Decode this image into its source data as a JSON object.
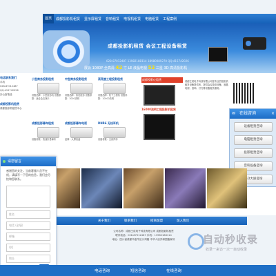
{
  "nav": {
    "items": [
      "首页",
      "成都投影机租赁",
      "显示屏租赁",
      "音响租赁",
      "电视机租赁",
      "电脑租赁",
      "工程案例"
    ]
  },
  "banner": {
    "headline": "成都投影机租赁 会议工程设备租赁",
    "contact": "028-87012487 13982188114 18980089270 QQ:415742026",
    "strip_pre": "展会 1080P 全高清",
    "strip_num1": "42",
    "strip_mid": "寸 LE 液晶电视",
    "strip_num2": "52",
    "strip_end": "三星 3D 高清投影机"
  },
  "sidebar": {
    "title": "电话联系我们",
    "lines": [
      "手机",
      "028-87012487",
      "QQ:415742026",
      "办公室电话"
    ],
    "title2": "成都投影机租赁",
    "lines2": [
      "成都投影机租赁中心"
    ]
  },
  "products": [
    {
      "title": "小型商务投影租赁",
      "desc": "设备品牌：小型投影机 设备参数：适合会议演示"
    },
    {
      "title": "中型商务投影租赁",
      "desc": "设备品牌：索尼投影 设备参数：3000流明"
    },
    {
      "title": "高亮度工程投影租赁",
      "desc": "设备品牌：松下工程机 设备参数：10000流明"
    },
    {
      "title": "成都投影幕布租赁",
      "desc": "设备参数：快速折叠幕布"
    },
    {
      "title": "成都投影幕布电视",
      "desc": "品牌：大屏液晶"
    },
    {
      "title": "DNR6 无线耳机",
      "desc": "设备参数：无线同传"
    }
  ],
  "mid": {
    "header": "成都投影仪租赁",
    "caption": "16000流明工程投影机租赁"
  },
  "right_info": "成都王成电子科技有限公司是专业的投影机租赁设备提供商，提供会议投影设备、液晶电视、音响、灯光等设备租赁服务。",
  "online": {
    "title": "在线咨询",
    "close": "×",
    "buttons": [
      "设备租赁咨询",
      "电脑租赁咨询",
      "投影租赁咨询",
      "音响设备咨询",
      "LED大屏咨询"
    ]
  },
  "chat": {
    "title": "请您留言",
    "message": "感谢您的关注，当前客服人员不在线，请填写一下您的信息，我们会尽快和您联系。",
    "fields": [
      "姓名",
      "电话 (必填)",
      "邮箱",
      "QQ",
      "地址"
    ],
    "send": "提交"
  },
  "footer_nav": [
    "关于我们",
    "联系我们",
    "招商加盟",
    "加入我们"
  ],
  "footer": {
    "company": "公司名称：成都王成电子科技有限公司 成都投影机租赁",
    "phone": "联系电话：028-87012487 手机：13982188114",
    "address": "地址：四川省成都市金牛区沙湾路 中华人民共和国备案号"
  },
  "bottom_bar": [
    "电话咨询",
    "短信咨询",
    "在线咨询"
  ],
  "watermark": {
    "big": "自动秒收录",
    "small": "收录一来访一次一自动收录"
  }
}
